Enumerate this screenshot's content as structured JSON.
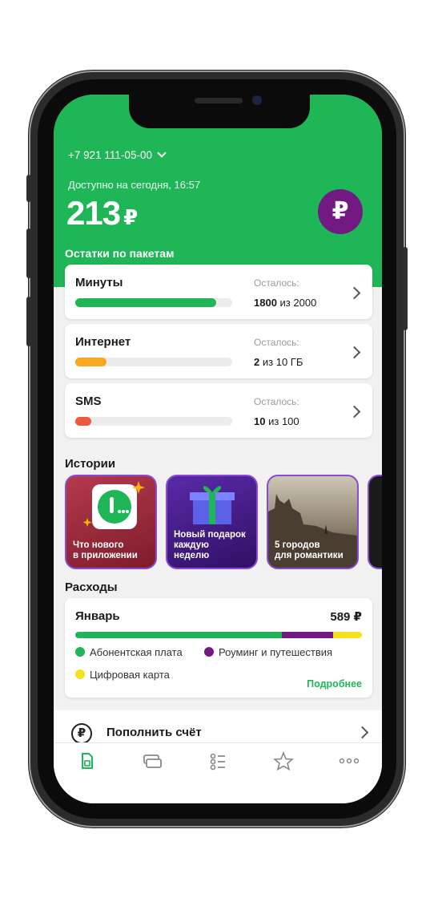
{
  "account": {
    "phone": "+7 921 111-05-00",
    "available_label": "Доступно на сегодня, 16:57",
    "balance": "213",
    "currency": "₽"
  },
  "packages": {
    "title": "Остатки по пакетам",
    "left_label": "Осталось:",
    "items": [
      {
        "name": "Минуты",
        "remaining": "1800",
        "sep": "из",
        "total": "2000",
        "fraction": 0.9,
        "color": "#1fb657"
      },
      {
        "name": "Интернет",
        "remaining": "2",
        "sep": "из",
        "total": "10 ГБ",
        "fraction": 0.2,
        "color": "#f7a823"
      },
      {
        "name": "SMS",
        "remaining": "10",
        "sep": "из",
        "total": "100",
        "fraction": 0.1,
        "color": "#ee5a3c"
      }
    ]
  },
  "stories": {
    "title": "Истории",
    "items": [
      {
        "caption_1": "Что нового",
        "caption_2": "в приложении"
      },
      {
        "caption_1": "Новый подарок",
        "caption_2": "каждую",
        "caption_3": "неделю"
      },
      {
        "caption_1": "5 городов",
        "caption_2": "для романтики"
      }
    ]
  },
  "expenses": {
    "title": "Расходы",
    "month": "Январь",
    "total": "589 ₽",
    "segments": [
      {
        "name": "Абонентская плата",
        "share": 0.72,
        "color": "#1fb657"
      },
      {
        "name": "Роуминг и путешествия",
        "share": 0.18,
        "color": "#731982"
      },
      {
        "name": "Цифровая карта",
        "share": 0.1,
        "color": "#f4e01d"
      }
    ],
    "more_link": "Подробнее"
  },
  "topup": {
    "icon": "₽",
    "label": "Пополнить счёт"
  },
  "tabbar": {
    "tabs": [
      {
        "icon": "sim-icon",
        "active": true
      },
      {
        "icon": "cards-icon",
        "active": false
      },
      {
        "icon": "services-icon",
        "active": false
      },
      {
        "icon": "star-icon",
        "active": false
      },
      {
        "icon": "more-icon",
        "active": false
      }
    ]
  },
  "colors": {
    "accent": "#1fb657",
    "brand_purple": "#731982"
  }
}
